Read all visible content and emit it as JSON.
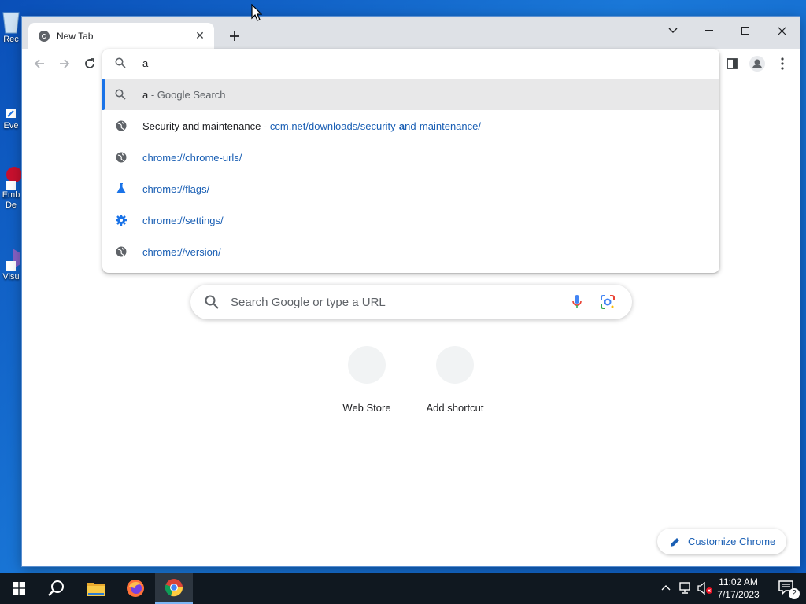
{
  "desktop": {
    "icons": [
      {
        "label": "Rec"
      },
      {
        "label": "Eve"
      },
      {
        "label": "Emb\nDe"
      },
      {
        "label": "Visu"
      }
    ]
  },
  "browser": {
    "tab": {
      "title": "New Tab"
    },
    "omnibox": {
      "query": "a",
      "suggestions": [
        {
          "type": "search",
          "query": "a",
          "separator": " - ",
          "label": "Google Search"
        },
        {
          "type": "history",
          "title_pre": "Security ",
          "title_bold": "a",
          "title_post": "nd maintenance",
          "separator": " - ",
          "url_pre": "ccm.net/downloads/security-",
          "url_bold": "a",
          "url_post": "nd-maintenance/"
        },
        {
          "type": "globe",
          "url": "chrome://chrome-urls/"
        },
        {
          "type": "flask",
          "url": "chrome://flags/"
        },
        {
          "type": "gear",
          "url": "chrome://settings/"
        },
        {
          "type": "globe",
          "url": "chrome://version/"
        }
      ]
    },
    "ntp": {
      "search_placeholder": "Search Google or type a URL",
      "shortcuts": [
        {
          "label": "Web Store"
        },
        {
          "label": "Add shortcut"
        }
      ],
      "customize_label": "Customize Chrome"
    }
  },
  "taskbar": {
    "time": "11:02 AM",
    "date": "7/17/2023",
    "notification_count": "2"
  },
  "colors": {
    "accent": "#1a73e8",
    "link": "#1a5fb4",
    "taskbar": "#101820"
  }
}
